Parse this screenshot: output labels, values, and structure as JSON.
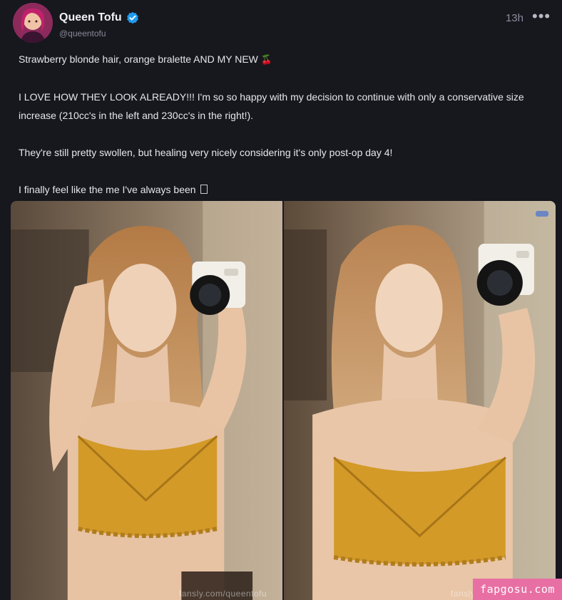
{
  "author": {
    "display_name": "Queen Tofu",
    "handle": "@queentofu",
    "verified": true,
    "avatar_icon": "avatar-image"
  },
  "post": {
    "timestamp": "13h",
    "more_label": "•••",
    "paragraphs": {
      "p1": "Strawberry blonde hair, orange bralette AND MY NEW",
      "p1_emoji": "🍒",
      "p2": "I LOVE HOW THEY LOOK ALREADY!!! I'm so so happy with my decision to continue with only a conservative size increase (210cc's in the left and 230cc's in the right!).",
      "p3": "They're still pretty swollen, but healing very nicely considering it's only post-op day 4!",
      "p4": "I finally feel like the me I've always been"
    }
  },
  "media": {
    "images": [
      {
        "watermark": "fansly.com/queentofu"
      },
      {
        "watermark": "fansly"
      }
    ]
  },
  "site_badge": {
    "text": "fapgosu.com"
  },
  "colors": {
    "background": "#17171e",
    "verified_blue": "#1d9bf0",
    "badge_pink": "#e86fa3",
    "bralette_orange": "#d39a28"
  }
}
